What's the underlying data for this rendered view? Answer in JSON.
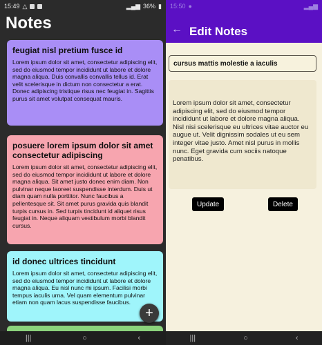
{
  "left": {
    "status": {
      "time": "15:49",
      "battery": "36%"
    },
    "app_title": "Notes",
    "notes": [
      {
        "title": "feugiat nisl pretium fusce id",
        "body": "Lorem ipsum dolor sit amet, consectetur adipiscing elit, sed do eiusmod tempor incididunt ut labore et dolore magna aliqua. Duis convallis convallis tellus id. Erat velit scelerisque in dictum non consectetur a erat. Donec adipiscing tristique risus nec feugiat in. Sagittis purus sit amet volutpat consequat mauris.",
        "color": "#a98ef6"
      },
      {
        "title": "posuere lorem ipsum dolor sit amet consectetur adipiscing",
        "body": "Lorem ipsum dolor sit amet, consectetur adipiscing elit, sed do eiusmod tempor incididunt ut labore et dolore magna aliqua. Sit amet justo donec enim diam. Non pulvinar neque laoreet suspendisse interdum. Duis ut diam quam nulla porttitor. Nunc faucibus a pellentesque sit. Sit amet purus gravida quis blandit turpis cursus in. Sed turpis tincidunt id aliquet risus feugiat in. Neque aliquam vestibulum morbi blandit cursus.",
        "color": "#f7a5af"
      },
      {
        "title": "id donec ultrices tincidunt",
        "body": "Lorem ipsum dolor sit amet, consectetur adipiscing elit, sed do eiusmod tempor incididunt ut labore et dolore magna aliqua. Eu nisl nunc mi ipsum. Facilisi morbi tempus iaculis urna. Vel quam elementum pulvinar etiam non quam lacus suspendisse faucibus.",
        "color": "#9ff5fb"
      }
    ],
    "fab_label": "+",
    "nav": {
      "recents": "|||",
      "home": "○",
      "back": "‹"
    }
  },
  "right": {
    "status": {
      "time": "15:50"
    },
    "screen_title": "Edit Notes",
    "back_icon": "←",
    "title_value": "cursus mattis molestie a iaculis",
    "body_value": "Lorem ipsum dolor sit amet, consectetur adipiscing elit, sed do eiusmod tempor incididunt ut labore et dolore magna aliqua. Nisl nisi scelerisque eu ultrices vitae auctor eu augue ut. Velit dignissim sodales ut eu sem integer vitae justo. Amet nisl purus in mollis nunc. Eget gravida cum sociis natoque penatibus.",
    "update_label": "Update",
    "delete_label": "Delete",
    "nav": {
      "recents": "|||",
      "home": "○",
      "back": "‹"
    }
  },
  "colors": {
    "accent": "#5b10c4",
    "dark_bg": "#2b2b2b",
    "edit_bg": "#f6f1de"
  }
}
